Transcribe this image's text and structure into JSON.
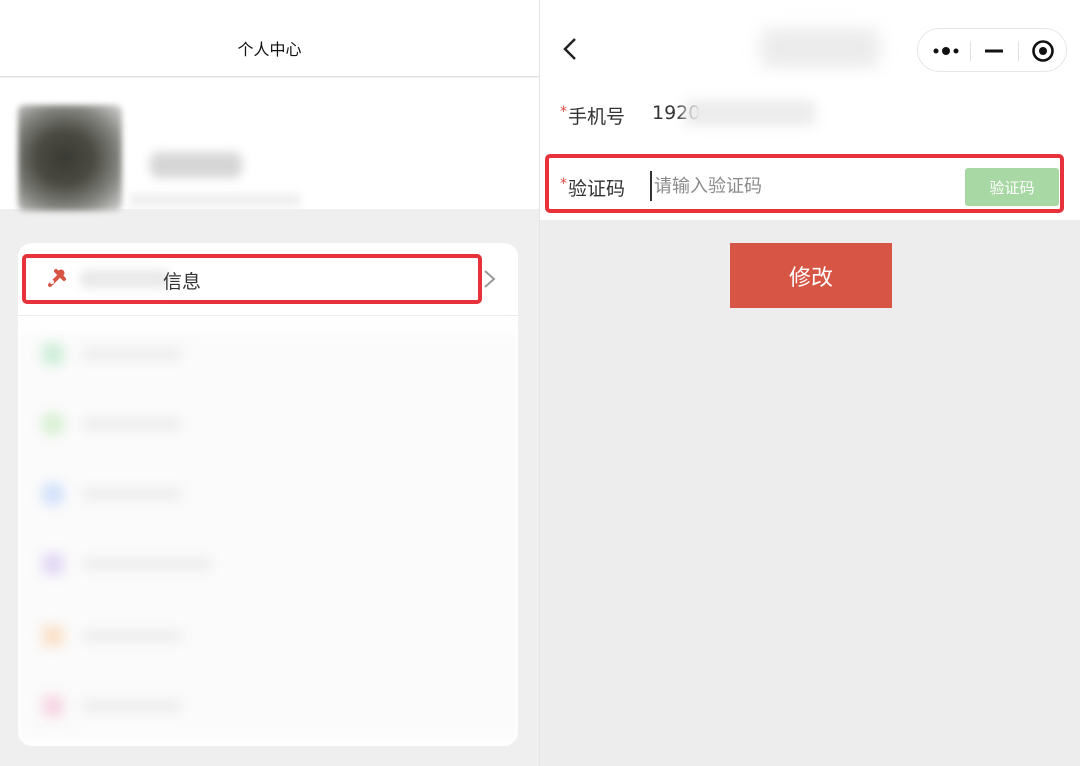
{
  "left": {
    "nav_title": "个人中心",
    "menu_item_label": "信息"
  },
  "right": {
    "form": {
      "required_mark": "*",
      "phone_label": "手机号",
      "phone_value": "1920",
      "code_label": "验证码",
      "code_placeholder": "请输入验证码",
      "code_button_label": "验证码"
    },
    "submit_label": "修改"
  },
  "colors": {
    "accent_red": "#d65544",
    "highlight_red": "#e8323b",
    "code_button_green": "#a8d9a5",
    "required_red": "#e04a3e"
  },
  "icons": [
    "tools-icon",
    "chevron-right-icon",
    "back-arrow-icon",
    "more-dots-icon",
    "minimize-icon",
    "close-target-icon"
  ]
}
